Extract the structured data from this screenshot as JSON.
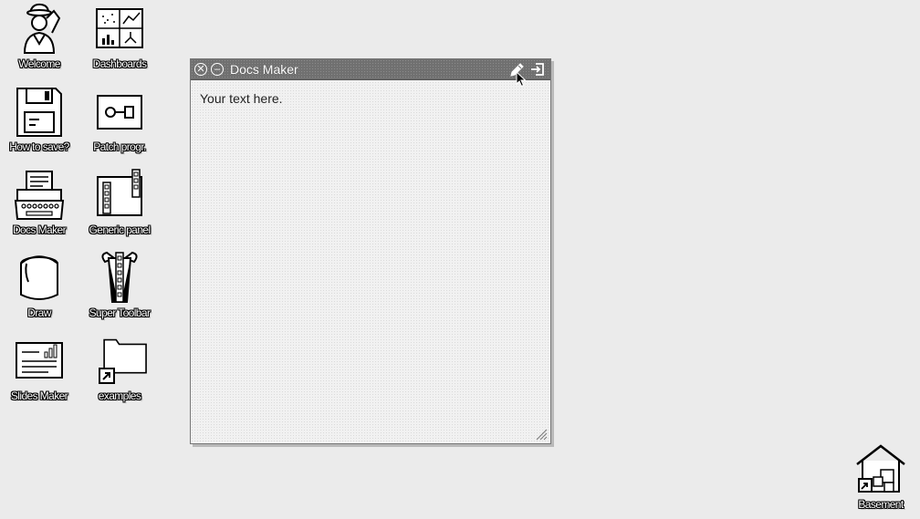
{
  "desktop": {
    "icons": [
      {
        "label": "Welcome",
        "icon": "welcome-person-icon"
      },
      {
        "label": "Dashboards",
        "icon": "dashboards-icon"
      },
      {
        "label": "How to save?",
        "icon": "floppy-disk-icon"
      },
      {
        "label": "Patch progr.",
        "icon": "patch-program-icon"
      },
      {
        "label": "Docs Maker",
        "icon": "typewriter-icon"
      },
      {
        "label": "Generic panel",
        "icon": "generic-panel-icon"
      },
      {
        "label": "Draw",
        "icon": "paint-bucket-icon"
      },
      {
        "label": "Super Toolbar",
        "icon": "super-toolbar-icon"
      },
      {
        "label": "Slides Maker",
        "icon": "slides-icon"
      },
      {
        "label": "examples",
        "icon": "folder-shortcut-icon"
      },
      {
        "label": "Basement",
        "icon": "basement-house-icon"
      }
    ]
  },
  "window": {
    "title": "Docs Maker",
    "body_text": "Your text here.",
    "controls": [
      "close-icon",
      "minimize-icon",
      "edit-pencil-icon",
      "exit-icon"
    ]
  }
}
